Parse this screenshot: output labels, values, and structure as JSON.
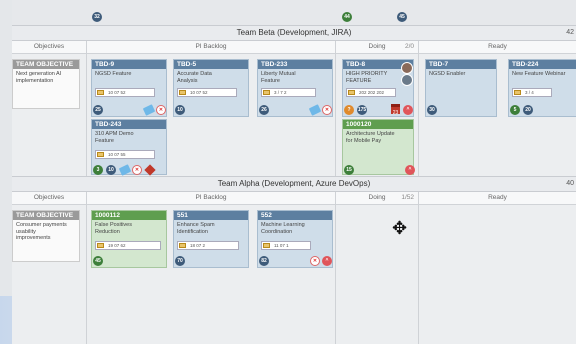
{
  "top_strip": {
    "badges": [
      "32",
      "44",
      "45"
    ]
  },
  "beta": {
    "title": "Team Beta (Development, JIRA)",
    "count": "42",
    "columns": {
      "objectives": "Objectives",
      "backlog": "PI Backlog",
      "doing": "Doing",
      "doing_count": "2/0",
      "ready": "Ready"
    },
    "objective_card": {
      "id": "TEAM OBJECTIVE",
      "text": "Next generation AI\nimplementation"
    },
    "cards": [
      {
        "id": "TBD-9",
        "title": "NGSD Feature",
        "meta": "10 07 52",
        "points": "25"
      },
      {
        "id": "TBD-5",
        "title": "Accurate Data\nAnalysis",
        "meta": "10 07 52",
        "points": "10"
      },
      {
        "id": "TBD-233",
        "title": "Liberty Mutual\nFeature",
        "meta": "3 / 7 2",
        "points": "26"
      },
      {
        "id": "TBD-243",
        "title": "310 APM Demo\nFeature",
        "meta": "10 07 55",
        "points": "10",
        "points2": "3"
      },
      {
        "id": "TBD-8",
        "title": "HIGH PRIORITY\nFEATURE",
        "meta": "202 202 202",
        "points": "175",
        "alert": "?",
        "date": "23"
      },
      {
        "id": "1000120",
        "title": "Architecture Update\nfor Mobile Pay",
        "points": "15"
      },
      {
        "id": "TBD-7",
        "title": "NGSD Enabler",
        "points": "30"
      },
      {
        "id": "TBD-224",
        "title": "New Feature Webinar",
        "meta": "3 / 4",
        "points": "20",
        "points2": "5"
      }
    ]
  },
  "alpha": {
    "title": "Team Alpha (Development, Azure DevOps)",
    "count": "40",
    "columns": {
      "objectives": "Objectives",
      "backlog": "PI Backlog",
      "doing": "Doing",
      "doing_count": "1/52",
      "ready": "Ready"
    },
    "objective_card": {
      "id": "TEAM OBJECTIVE",
      "text": "Consumer payments\nusability\nimprovements"
    },
    "cards": [
      {
        "id": "1000112",
        "title": "False Positives\nReduction",
        "meta": "19 07 62",
        "points": "45"
      },
      {
        "id": "551",
        "title": "Enhance Spam\nIdentification",
        "meta": "18 07 2",
        "points": "70"
      },
      {
        "id": "552",
        "title": "Machine Learning\nCoordination",
        "meta": "11 07 1",
        "points": "82"
      }
    ]
  },
  "move_cursor": "✥"
}
